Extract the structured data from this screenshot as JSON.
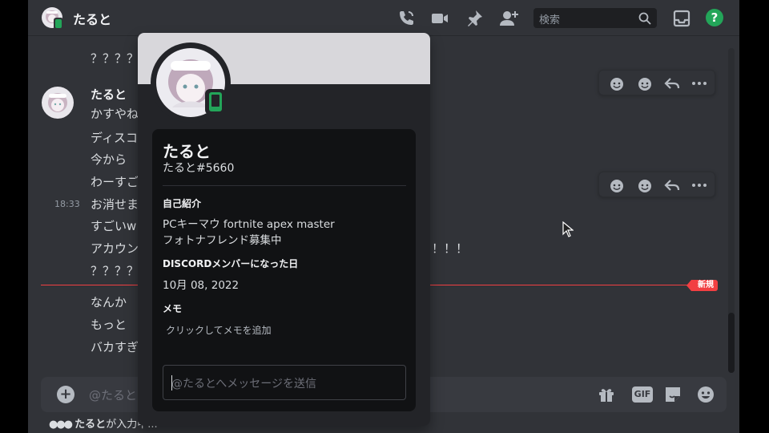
{
  "header": {
    "title": "たると",
    "search_placeholder": "検索",
    "help_label": "?"
  },
  "messages": {
    "partial_top": "？？？？",
    "author": "たると",
    "lines": [
      "かすやね",
      "ディスコ",
      "今から",
      "わーすご",
      "お消せま",
      "すごいw",
      "アカウン",
      "？？？？"
    ],
    "line_tail": "！！！",
    "timestamp": "18:33",
    "after_new": [
      "なんか",
      "もっと",
      "バカすぎ"
    ],
    "new_label": "新規"
  },
  "composer": {
    "placeholder": "@たると",
    "plus_label": "+",
    "gif_label": "GIF"
  },
  "typing": {
    "name": "たると",
    "text": "が入力中..."
  },
  "profile": {
    "display_name": "たると",
    "tag": "たると#5660",
    "about_heading": "自己紹介",
    "about_lines": [
      "PCキーマウ fortnite apex master",
      "フォトナフレンド募集中"
    ],
    "member_since_heading": "DISCORDメンバーになった日",
    "member_since": "10月 08, 2022",
    "note_heading": "メモ",
    "note_placeholder": "クリックしてメモを追加",
    "message_placeholder": "@たるとへメッセージを送信"
  },
  "colors": {
    "bg": "#313338",
    "popout": "#232428",
    "online": "#23a559",
    "new_divider": "#f23f42"
  }
}
